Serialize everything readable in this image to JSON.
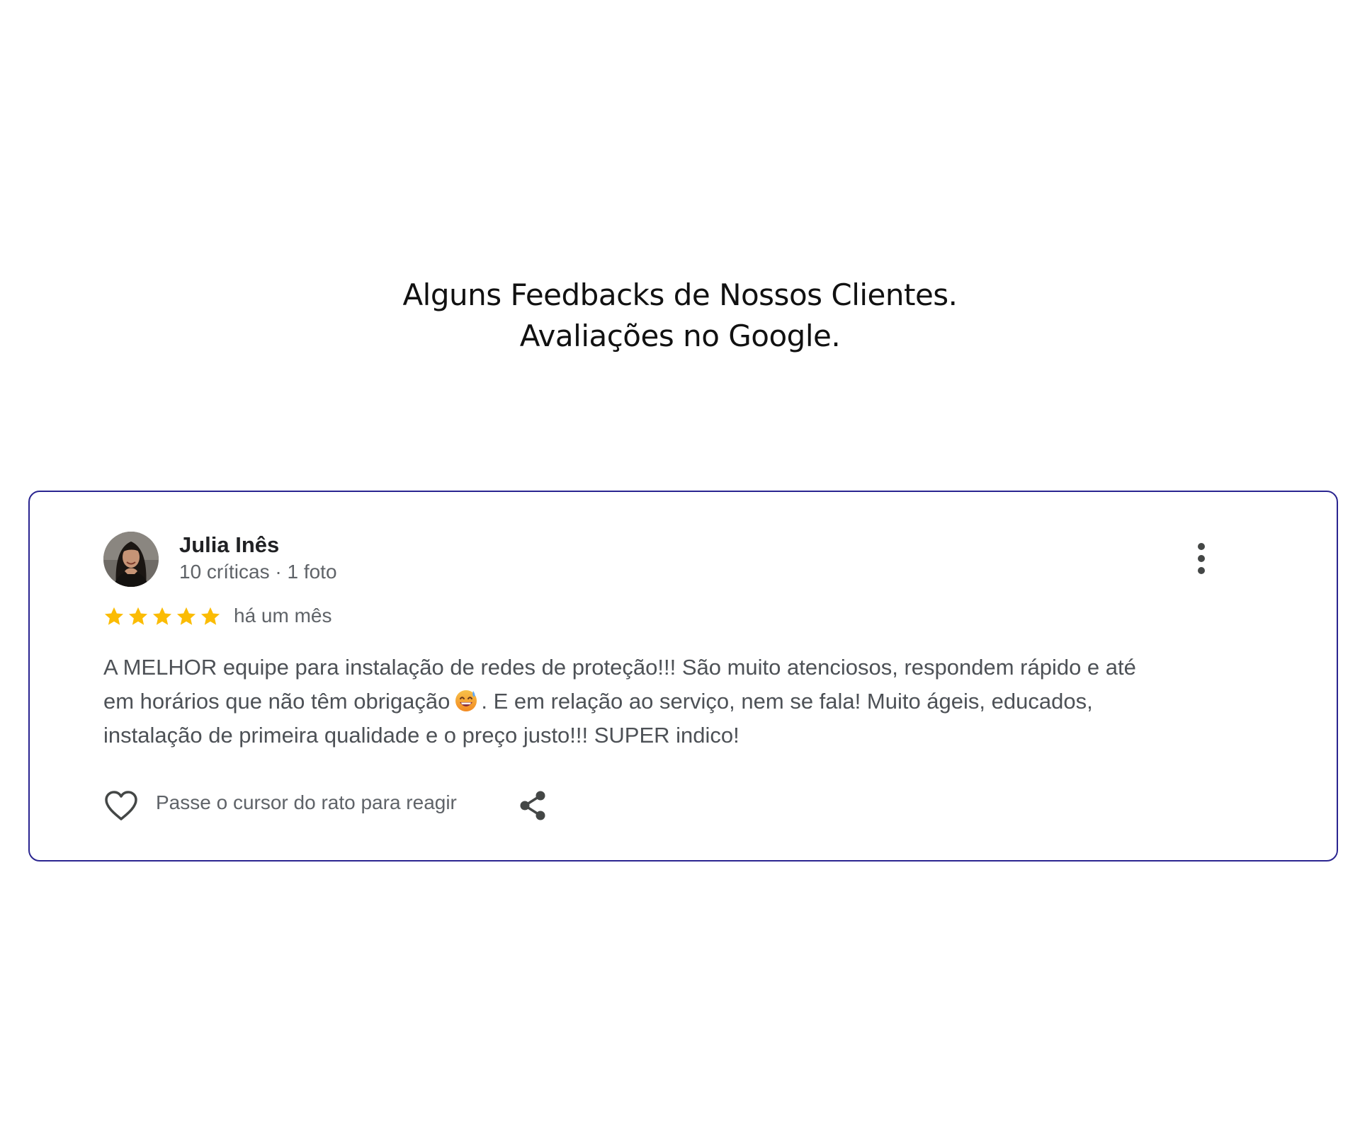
{
  "header": {
    "line1": "Alguns Feedbacks de Nossos Clientes.",
    "line2": "Avaliações no Google."
  },
  "review": {
    "reviewer_name": "Julia Inês",
    "reviewer_meta": "10 críticas · 1 foto",
    "rating": 5,
    "rating_max": 5,
    "date": "há um mês",
    "text_line1": "A MELHOR equipe para instalação de redes de proteção!!! São muito atenciosos, respondem rápido e até",
    "text_line2_before_emoji": "em horários que não têm obrigação",
    "emoji": "smiling-face-with-sweat-emoji",
    "text_line2_after_emoji": ". E em relação ao serviço, nem se fala! Muito ágeis, educados,",
    "text_line3": "instalação de primeira qualidade e o preço justo!!! SUPER indico!",
    "react_hint": "Passe o cursor do rato para reagir"
  },
  "colors": {
    "card_border": "#2a2590",
    "star": "#fbbc04",
    "body_text": "#4d5156",
    "meta_text": "#5f6368",
    "icon": "#444746"
  },
  "icons": {
    "more": "more-vertical-icon",
    "like": "heart-outline-icon",
    "share": "share-icon",
    "star": "star-icon"
  }
}
